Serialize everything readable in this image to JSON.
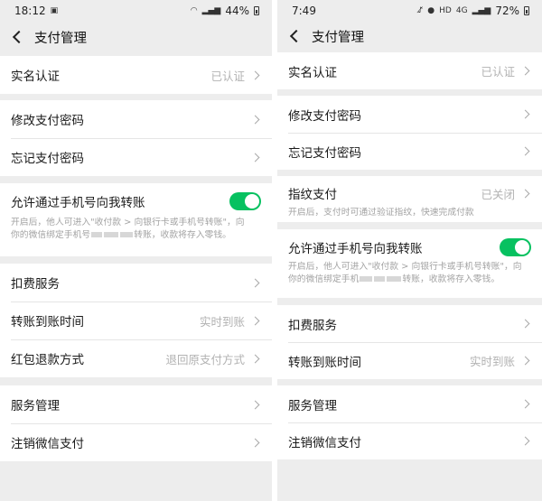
{
  "left": {
    "status": {
      "time": "18:12",
      "image_icon": "image-icon",
      "wifi_icon": "wifi-icon",
      "signal_icon": "signal-icon",
      "battery": "44%"
    },
    "nav": {
      "title": "支付管理"
    },
    "verify": {
      "label": "实名认证",
      "value": "已认证"
    },
    "change_pwd": {
      "label": "修改支付密码"
    },
    "forgot_pwd": {
      "label": "忘记支付密码"
    },
    "phone_transfer": {
      "label": "允许通过手机号向我转账",
      "desc_line1": "开启后，他人可进入\"收付款 > 向银行卡或手机号转账\"，向",
      "desc_line2_a": "你的微信绑定手机号",
      "desc_line2_b": "转账，收款将存入零钱。",
      "enabled": true
    },
    "deduct": {
      "label": "扣费服务"
    },
    "arrival": {
      "label": "转账到账时间",
      "value": "实时到账"
    },
    "refund": {
      "label": "红包退款方式",
      "value": "退回原支付方式"
    },
    "service_mgmt": {
      "label": "服务管理"
    },
    "cancel_pay": {
      "label": "注销微信支付"
    }
  },
  "right": {
    "status": {
      "time": "7:49",
      "mute_icon": "mute-icon",
      "location_icon": "location-icon",
      "hd_icon": "HD",
      "lte_icon": "4G",
      "battery": "72%"
    },
    "nav": {
      "title": "支付管理"
    },
    "verify": {
      "label": "实名认证",
      "value": "已认证"
    },
    "change_pwd": {
      "label": "修改支付密码"
    },
    "forgot_pwd": {
      "label": "忘记支付密码"
    },
    "fingerprint": {
      "label": "指纹支付",
      "value": "已关闭",
      "desc": "开启后，支付时可通过验证指纹，快速完成付款"
    },
    "phone_transfer": {
      "label": "允许通过手机号向我转账",
      "desc_line1": "开启后，他人可进入\"收付款 > 向银行卡或手机号转账\"，向",
      "desc_line2_a": "你的微信绑定手机",
      "desc_line2_b": "转账，收款将存入零钱。",
      "enabled": true
    },
    "deduct": {
      "label": "扣费服务"
    },
    "arrival": {
      "label": "转账到账时间",
      "value": "实时到账"
    },
    "service_mgmt": {
      "label": "服务管理"
    },
    "cancel_pay": {
      "label": "注销微信支付"
    }
  },
  "colors": {
    "toggle_on": "#07c160",
    "page_bg": "#ededed",
    "secondary_text": "#b2b2b2"
  }
}
